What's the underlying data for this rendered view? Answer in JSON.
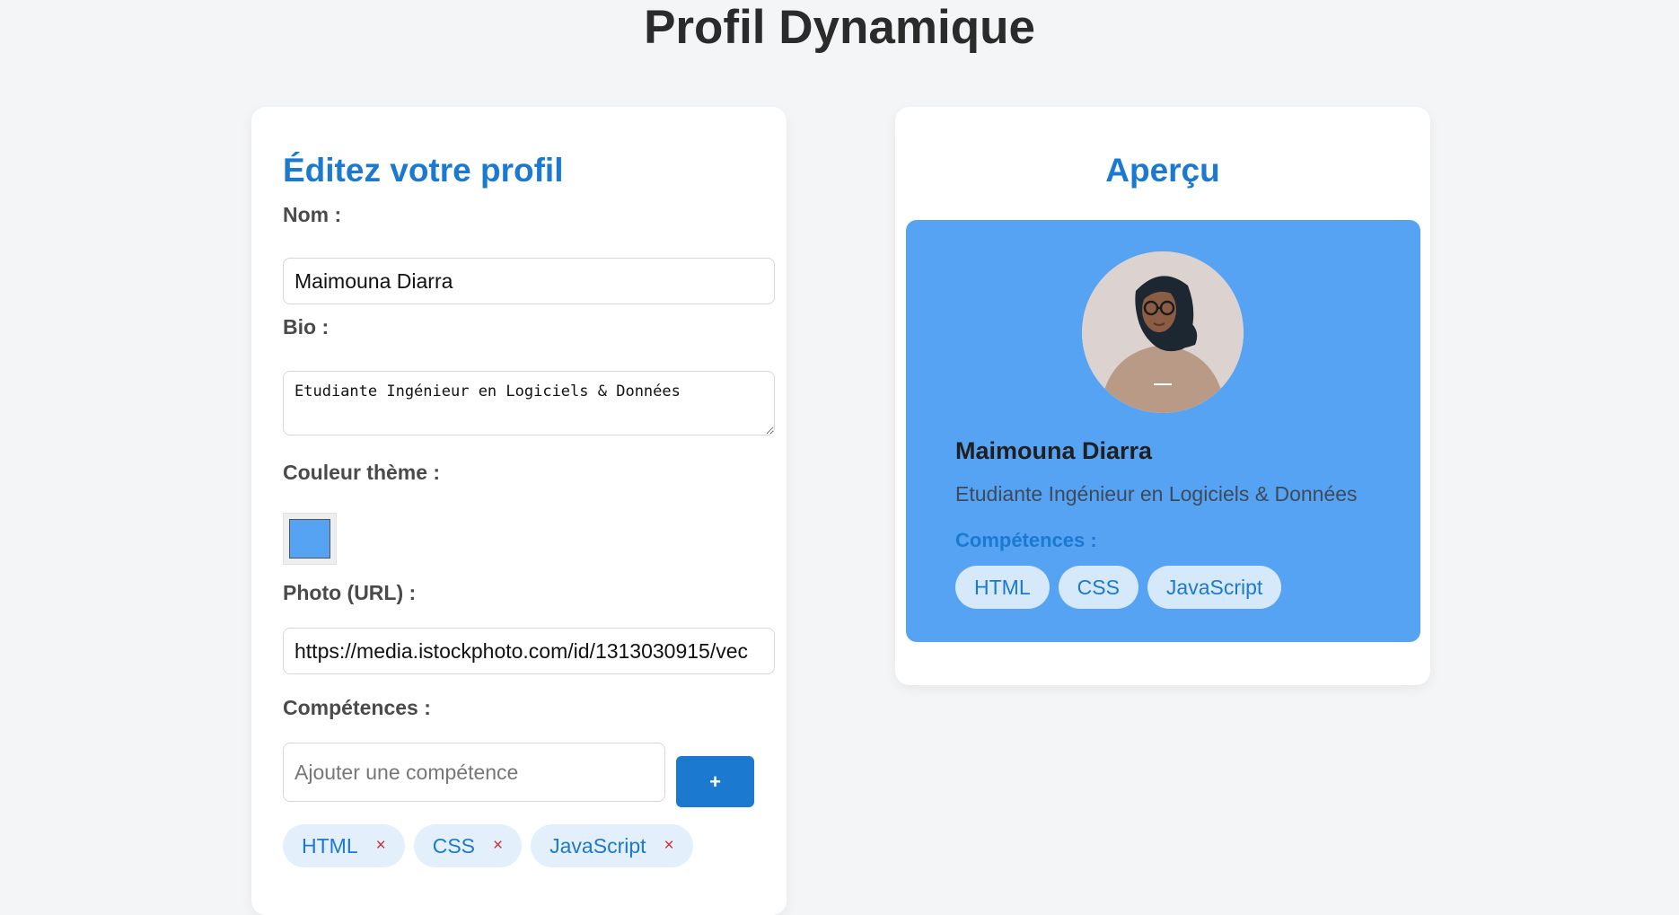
{
  "page": {
    "title": "Profil Dynamique"
  },
  "editor": {
    "title": "Éditez votre profil",
    "name_label": "Nom :",
    "name_value": "Maimouna Diarra",
    "bio_label": "Bio :",
    "bio_value": "Etudiante Ingénieur en Logiciels & Données",
    "color_label": "Couleur thème :",
    "color_value": "#56a3f3",
    "photo_label": "Photo (URL) :",
    "photo_value": "https://media.istockphoto.com/id/1313030915/vec",
    "skills_label": "Compétences :",
    "skill_placeholder": "Ajouter une compétence",
    "add_label": "+",
    "remove_glyph": "×",
    "skills": [
      "HTML",
      "CSS",
      "JavaScript"
    ]
  },
  "preview": {
    "title": "Aperçu",
    "name": "Maimouna Diarra",
    "bio": "Etudiante Ingénieur en Logiciels & Données",
    "skills_label": "Compétences :",
    "skills": [
      "HTML",
      "CSS",
      "JavaScript"
    ],
    "avatar_icon": "avatar-illustration"
  },
  "colors": {
    "accent": "#1b79d0",
    "theme": "#56a3f3"
  }
}
